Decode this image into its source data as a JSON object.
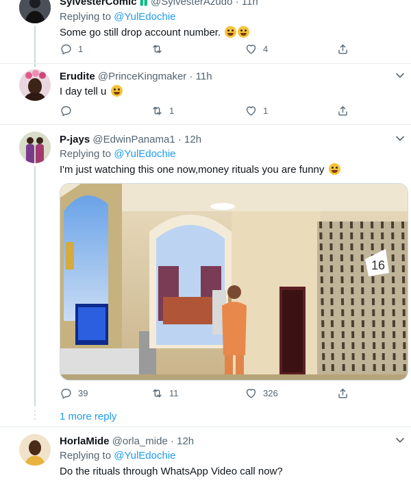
{
  "tweets": [
    {
      "name": "SylvesterComic",
      "handle": "@SylvesterAzudo",
      "time": "· 11h",
      "replying_prefix": "Replying to ",
      "replying_to": "@YulEdochie",
      "text": "Some go still drop account number.",
      "replies": "1",
      "retweets": "",
      "likes": "4"
    },
    {
      "name": "Erudite",
      "handle": "@PrinceKingmaker",
      "time": "· 11h",
      "text": "I day tell u",
      "replies": "",
      "retweets": "1",
      "likes": "1"
    },
    {
      "name": "P-jays",
      "handle": "@EdwinPanama1",
      "time": "· 12h",
      "replying_prefix": "Replying to ",
      "replying_to": "@YulEdochie",
      "text": "I'm just watching this one now,money rituals you are funny",
      "media_label": "16",
      "replies": "39",
      "retweets": "11",
      "likes": "326"
    },
    {
      "name": "HorlaMide",
      "handle": "@orla_mide",
      "time": "· 12h",
      "replying_prefix": "Replying to ",
      "replying_to": "@YulEdochie",
      "text": "Do the rituals through WhatsApp Video call now?"
    }
  ],
  "more_reply_label": "1 more reply",
  "colors": {
    "accent": "#1d9bf0",
    "secondary_text": "#536471",
    "divider": "#e6ecf0"
  },
  "icons": [
    "reply-icon",
    "retweet-icon",
    "like-icon",
    "share-icon",
    "caret-down-icon"
  ]
}
